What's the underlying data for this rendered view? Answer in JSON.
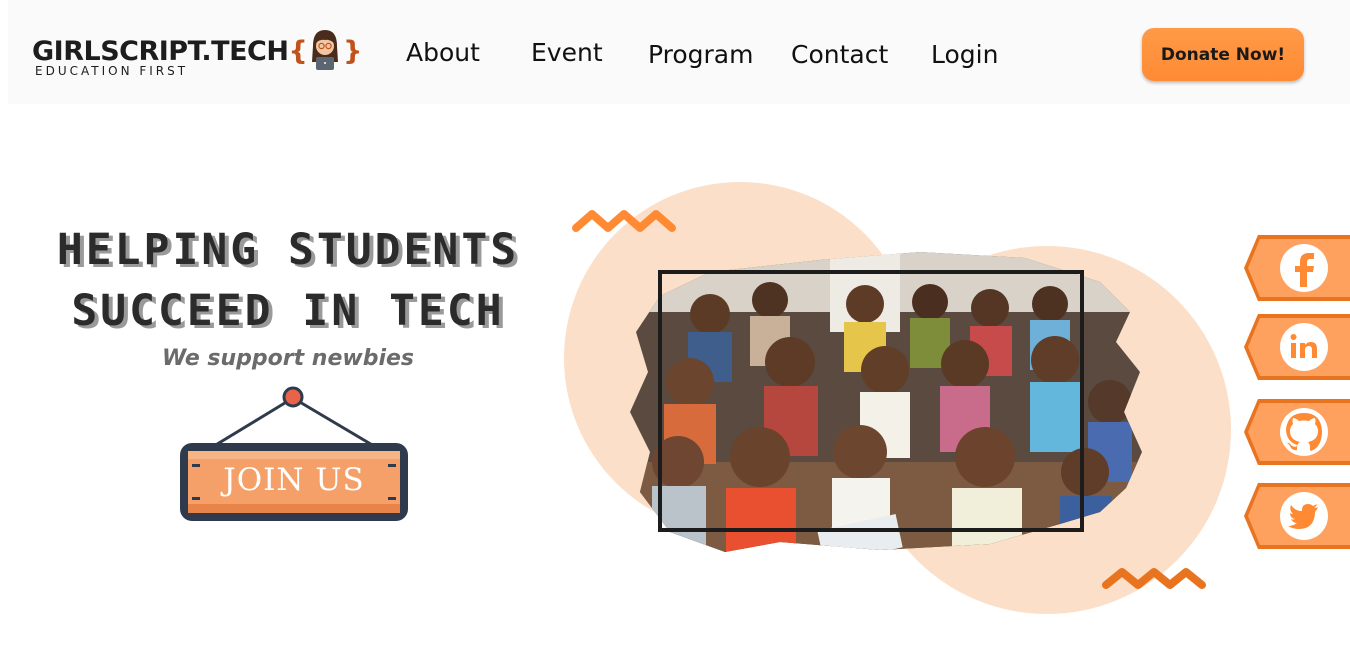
{
  "brand": {
    "name": "GIRLSCRIPT.TECH",
    "brace_open": "{",
    "brace_close": "}",
    "tagline": "EDUCATION FIRST"
  },
  "nav": {
    "about": "About",
    "event": "Event",
    "program": "Program",
    "contact": "Contact",
    "login": "Login"
  },
  "donate": {
    "label": "Donate Now!"
  },
  "hero": {
    "title_line1": "HELPING STUDENTS",
    "title_line2": "SUCCEED IN TECH",
    "subtitle": "We support newbies",
    "join_label": "JOIN US"
  },
  "social": [
    {
      "name": "facebook",
      "icon": "facebook-icon"
    },
    {
      "name": "linkedin",
      "icon": "linkedin-icon"
    },
    {
      "name": "github",
      "icon": "github-icon"
    },
    {
      "name": "twitter",
      "icon": "twitter-icon"
    }
  ],
  "colors": {
    "accent": "#ff8a34",
    "accent_dark": "#e8741f",
    "peach": "#fbdfc8",
    "text_dark": "#2b2b2b",
    "sign_frame": "#2f3b4c"
  }
}
